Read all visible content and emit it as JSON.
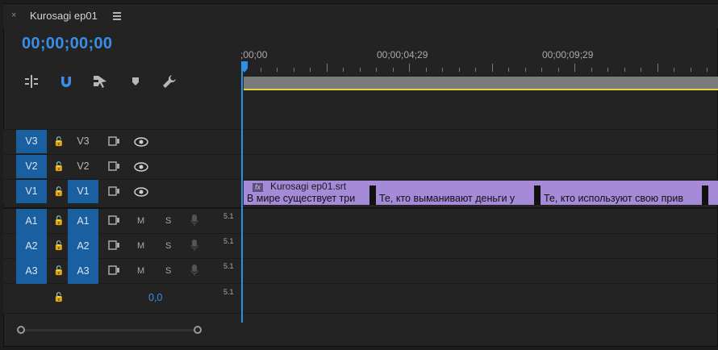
{
  "tab": {
    "close": "×",
    "title": "Kurosagi ep01",
    "menu_icon": "hamburger-menu-icon"
  },
  "timecode": "00;00;00;00",
  "tools": [
    {
      "name": "insert-overwrite-icon"
    },
    {
      "name": "snap-magnet-icon"
    },
    {
      "name": "linked-selection-icon"
    },
    {
      "name": "add-marker-icon"
    },
    {
      "name": "timeline-settings-wrench-icon"
    }
  ],
  "ruler": {
    "labels": [
      ";00;00",
      "00;00;04;29",
      "00;00;09;29"
    ]
  },
  "video_tracks": [
    {
      "label": "V3",
      "source": "V3"
    },
    {
      "label": "V2",
      "source": "V2"
    },
    {
      "label": "V1",
      "source": "V1"
    }
  ],
  "audio_tracks": [
    {
      "label": "A1",
      "source": "A1",
      "mute": "M",
      "solo": "S",
      "meter": "5.1"
    },
    {
      "label": "A2",
      "source": "A2",
      "mute": "M",
      "solo": "S",
      "meter": "5.1"
    },
    {
      "label": "A3",
      "source": "A3",
      "mute": "M",
      "solo": "S",
      "meter": "5.1"
    }
  ],
  "master": {
    "value": "0,0",
    "meter": "5.1"
  },
  "clip": {
    "name": "Kurosagi ep01.srt",
    "fx": "fx",
    "segments": [
      "В мире существует три",
      "Те, кто выманивают деньги у",
      "Те, кто используют свою прив"
    ]
  },
  "colors": {
    "accent": "#2f8fe6",
    "track_on": "#1a5fa0",
    "clip": "#a58ad8",
    "work_area": "#e1d63a"
  }
}
